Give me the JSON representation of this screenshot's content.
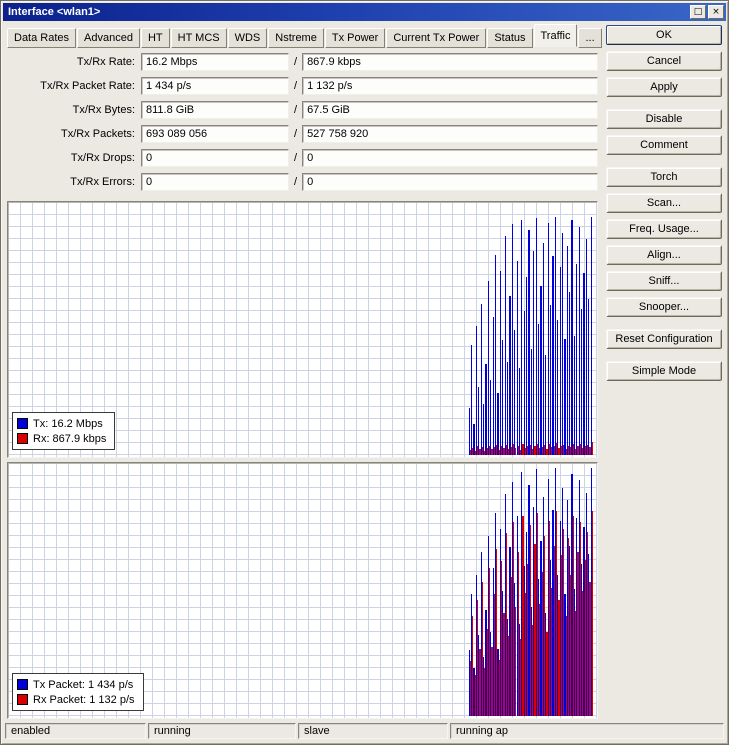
{
  "window": {
    "title": "Interface <wlan1>",
    "maximize_glyph": "□",
    "close_glyph": "×"
  },
  "tabs": {
    "items": [
      "Data Rates",
      "Advanced",
      "HT",
      "HT MCS",
      "WDS",
      "Nstreme",
      "Tx Power",
      "Current Tx Power",
      "Status",
      "Traffic",
      "..."
    ],
    "active_index": 9
  },
  "fields": [
    {
      "label": "Tx/Rx Rate:",
      "tx": "16.2 Mbps",
      "rx": "867.9 kbps"
    },
    {
      "label": "Tx/Rx Packet Rate:",
      "tx": "1 434 p/s",
      "rx": "1 132 p/s"
    },
    {
      "label": "Tx/Rx Bytes:",
      "tx": "811.8 GiB",
      "rx": "67.5 GiB"
    },
    {
      "label": "Tx/Rx Packets:",
      "tx": "693 089 056",
      "rx": "527 758 920"
    },
    {
      "label": "Tx/Rx Drops:",
      "tx": "0",
      "rx": "0"
    },
    {
      "label": "Tx/Rx Errors:",
      "tx": "0",
      "rx": "0"
    }
  ],
  "action_buttons": [
    {
      "label": "OK",
      "group": 0,
      "default": true
    },
    {
      "label": "Cancel",
      "group": 0
    },
    {
      "label": "Apply",
      "group": 0
    },
    {
      "label": "Disable",
      "group": 1
    },
    {
      "label": "Comment",
      "group": 1
    },
    {
      "label": "Torch",
      "group": 2
    },
    {
      "label": "Scan...",
      "group": 2
    },
    {
      "label": "Freq. Usage...",
      "group": 2
    },
    {
      "label": "Align...",
      "group": 2
    },
    {
      "label": "Sniff...",
      "group": 2
    },
    {
      "label": "Snooper...",
      "group": 2
    },
    {
      "label": "Reset Configuration",
      "group": 3
    },
    {
      "label": "Simple Mode",
      "group": 4
    }
  ],
  "colors": {
    "tx": "#0000d8",
    "rx": "#d80000"
  },
  "charts": [
    {
      "name": "traffic-rate",
      "type": "bar",
      "ymax": 17,
      "legend": [
        {
          "label": "Tx:  16.2 Mbps",
          "color": "#0000d8"
        },
        {
          "label": "Rx:  867.9 kbps",
          "color": "#d80000"
        }
      ],
      "series": [
        {
          "name": "Tx",
          "color": "#0000d8",
          "values": [
            3.2,
            7.5,
            2.1,
            8.8,
            4.6,
            10.3,
            3.5,
            6.2,
            11.8,
            5.1,
            9.4,
            13.6,
            4.2,
            12.5,
            7.8,
            14.9,
            6.3,
            10.8,
            15.7,
            8.5,
            13.2,
            5.9,
            16.0,
            9.8,
            12.1,
            15.3,
            7.2,
            13.9,
            16.1,
            8.9,
            11.5,
            14.4,
            6.8,
            15.8,
            10.2,
            13.5,
            16.2,
            9.2,
            12.8,
            15.1,
            7.9,
            14.2,
            11.1,
            16.0,
            8.1,
            13.0,
            15.5,
            9.9,
            12.4,
            14.7,
            10.6,
            16.2
          ]
        },
        {
          "name": "Rx",
          "color": "#d80000",
          "values": [
            0.35,
            0.5,
            0.28,
            0.6,
            0.42,
            0.55,
            0.3,
            0.48,
            0.62,
            0.38,
            0.52,
            0.66,
            0.33,
            0.58,
            0.45,
            0.7,
            0.4,
            0.56,
            0.72,
            0.46,
            0.6,
            0.36,
            0.75,
            0.5,
            0.58,
            0.68,
            0.42,
            0.62,
            0.78,
            0.48,
            0.56,
            0.66,
            0.4,
            0.72,
            0.52,
            0.62,
            0.8,
            0.46,
            0.58,
            0.7,
            0.44,
            0.64,
            0.54,
            0.76,
            0.42,
            0.6,
            0.72,
            0.5,
            0.58,
            0.68,
            0.52,
            0.87
          ]
        }
      ]
    },
    {
      "name": "packet-rate",
      "type": "bar",
      "ymax": 1600,
      "legend": [
        {
          "label": "Tx Packet:  1 434 p/s",
          "color": "#0000d8"
        },
        {
          "label": "Rx Packet:  1 132 p/s",
          "color": "#d80000"
        }
      ],
      "series": [
        {
          "name": "Tx Packet",
          "color": "#0000d8",
          "values": [
            420,
            780,
            310,
            900,
            520,
            1050,
            380,
            680,
            1150,
            540,
            950,
            1300,
            430,
            1200,
            800,
            1420,
            620,
            1080,
            1500,
            850,
            1280,
            590,
            1560,
            960,
            1180,
            1480,
            700,
            1340,
            1580,
            880,
            1120,
            1400,
            660,
            1520,
            1000,
            1320,
            1590,
            900,
            1250,
            1460,
            780,
            1380,
            1090,
            1550,
            810,
            1270,
            1510,
            970,
            1210,
            1430,
            1040,
            1590
          ]
        },
        {
          "name": "Rx Packet",
          "color": "#d80000",
          "values": [
            350,
            640,
            260,
            740,
            430,
            860,
            310,
            560,
            950,
            440,
            780,
            1070,
            360,
            990,
            660,
            1170,
            510,
            890,
            1240,
            700,
            1050,
            490,
            1280,
            790,
            970,
            1220,
            580,
            1100,
            1300,
            720,
            920,
            1150,
            540,
            1250,
            820,
            1090,
            1310,
            740,
            1030,
            1200,
            640,
            1140,
            900,
            1280,
            670,
            1050,
            1240,
            800,
            1000,
            1180,
            860,
            1310
          ]
        }
      ]
    }
  ],
  "statusbar": [
    "enabled",
    "running",
    "slave",
    "running ap"
  ]
}
